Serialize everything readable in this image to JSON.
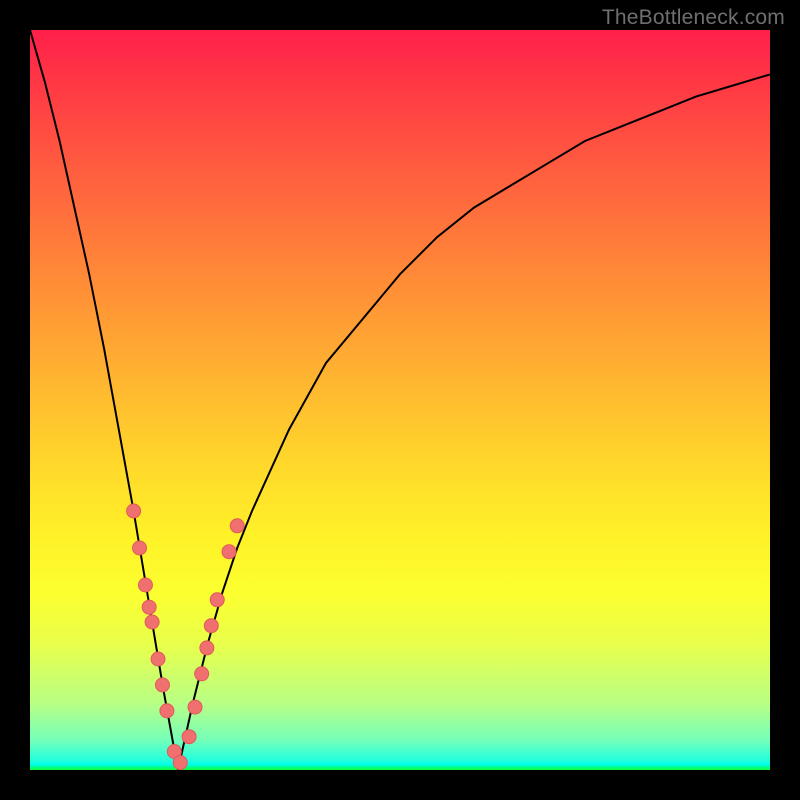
{
  "watermark": "TheBottleneck.com",
  "colors": {
    "background": "#000000",
    "curve": "#000000",
    "marker_fill": "#f07070",
    "marker_stroke": "#e05a5a"
  },
  "chart_data": {
    "type": "line",
    "title": "",
    "xlabel": "",
    "ylabel": "",
    "xlim": [
      0,
      100
    ],
    "ylim": [
      0,
      100
    ],
    "note": "V-shaped bottleneck curve; y is percentage mismatch, x is relative capability. Minimum near x≈20. Values estimated from pixel positions.",
    "x": [
      0,
      2,
      4,
      6,
      8,
      10,
      12,
      14,
      16,
      18,
      20,
      22,
      24,
      26,
      28,
      30,
      35,
      40,
      45,
      50,
      55,
      60,
      65,
      70,
      75,
      80,
      85,
      90,
      95,
      100
    ],
    "y": [
      100,
      93,
      85,
      76,
      67,
      57,
      46,
      35,
      23,
      11,
      0,
      9,
      17,
      24,
      30,
      35,
      46,
      55,
      61,
      67,
      72,
      76,
      79,
      82,
      85,
      87,
      89,
      91,
      92.5,
      94
    ],
    "series": [
      {
        "name": "curve",
        "x": [
          0,
          2,
          4,
          6,
          8,
          10,
          12,
          14,
          16,
          18,
          20,
          22,
          24,
          26,
          28,
          30,
          35,
          40,
          45,
          50,
          55,
          60,
          65,
          70,
          75,
          80,
          85,
          90,
          95,
          100
        ],
        "y": [
          100,
          93,
          85,
          76,
          67,
          57,
          46,
          35,
          23,
          11,
          0,
          9,
          17,
          24,
          30,
          35,
          46,
          55,
          61,
          67,
          72,
          76,
          79,
          82,
          85,
          87,
          89,
          91,
          92.5,
          94
        ]
      }
    ],
    "markers": [
      {
        "x": 14.0,
        "y": 35.0
      },
      {
        "x": 14.8,
        "y": 30.0
      },
      {
        "x": 15.6,
        "y": 25.0
      },
      {
        "x": 16.1,
        "y": 22.0
      },
      {
        "x": 16.5,
        "y": 20.0
      },
      {
        "x": 17.3,
        "y": 15.0
      },
      {
        "x": 17.9,
        "y": 11.5
      },
      {
        "x": 18.5,
        "y": 8.0
      },
      {
        "x": 19.5,
        "y": 2.5
      },
      {
        "x": 20.3,
        "y": 1.0
      },
      {
        "x": 21.5,
        "y": 4.5
      },
      {
        "x": 22.3,
        "y": 8.5
      },
      {
        "x": 23.2,
        "y": 13.0
      },
      {
        "x": 23.9,
        "y": 16.5
      },
      {
        "x": 24.5,
        "y": 19.5
      },
      {
        "x": 25.3,
        "y": 23.0
      },
      {
        "x": 26.9,
        "y": 29.5
      },
      {
        "x": 28.0,
        "y": 33.0
      }
    ]
  }
}
